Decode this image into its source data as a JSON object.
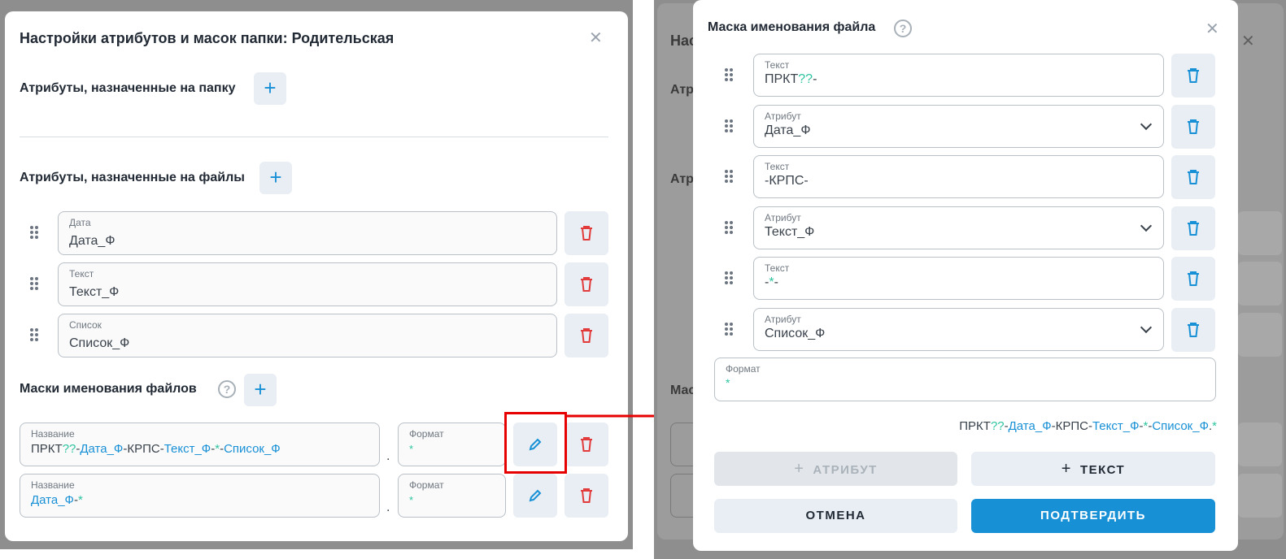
{
  "left": {
    "title": "Настройки атрибутов и масок папки: Родительская",
    "folder_attrs_label": "Атрибуты, назначенные на папку",
    "file_attrs_label": "Атрибуты, назначенные на файлы",
    "file_attrs": [
      {
        "label": "Дата",
        "value": "Дата_Ф"
      },
      {
        "label": "Текст",
        "value": "Текст_Ф"
      },
      {
        "label": "Список",
        "value": "Список_Ф"
      }
    ],
    "masks_label": "Маски именования файлов",
    "masks": [
      {
        "name_label": "Название",
        "name_parts": [
          {
            "t": "ПРКТ",
            "c": "dark"
          },
          {
            "t": "??",
            "c": "green"
          },
          {
            "t": "-",
            "c": "dark"
          },
          {
            "t": "Дата_Ф",
            "c": "blue"
          },
          {
            "t": "-КРПС-",
            "c": "dark"
          },
          {
            "t": "Текст_Ф",
            "c": "blue"
          },
          {
            "t": "-",
            "c": "dark"
          },
          {
            "t": "*",
            "c": "green"
          },
          {
            "t": "-",
            "c": "dark"
          },
          {
            "t": "Список_Ф",
            "c": "blue"
          }
        ],
        "format_label": "Формат",
        "format_value": "*"
      },
      {
        "name_label": "Название",
        "name_parts": [
          {
            "t": "Дата_Ф",
            "c": "blue"
          },
          {
            "t": "-",
            "c": "dark"
          },
          {
            "t": "*",
            "c": "green"
          }
        ],
        "format_label": "Формат",
        "format_value": "*"
      }
    ]
  },
  "right": {
    "title": "Маска именования файла",
    "rows": [
      {
        "label": "Текст",
        "parts": [
          {
            "t": "ПРКТ",
            "c": "dark"
          },
          {
            "t": "??",
            "c": "green"
          },
          {
            "t": "-",
            "c": "dark"
          }
        ],
        "dropdown": false
      },
      {
        "label": "Атрибут",
        "parts": [
          {
            "t": "Дата_Ф",
            "c": "dark"
          }
        ],
        "dropdown": true
      },
      {
        "label": "Текст",
        "parts": [
          {
            "t": "-КРПС-",
            "c": "dark"
          }
        ],
        "dropdown": false
      },
      {
        "label": "Атрибут",
        "parts": [
          {
            "t": "Текст_Ф",
            "c": "dark"
          }
        ],
        "dropdown": true
      },
      {
        "label": "Текст",
        "parts": [
          {
            "t": "-",
            "c": "dark"
          },
          {
            "t": "*",
            "c": "green"
          },
          {
            "t": "-",
            "c": "dark"
          }
        ],
        "dropdown": false
      },
      {
        "label": "Атрибут",
        "parts": [
          {
            "t": "Список_Ф",
            "c": "dark"
          }
        ],
        "dropdown": true
      }
    ],
    "format_label": "Формат",
    "format_value": "*",
    "preview_parts": [
      {
        "t": "ПРКТ",
        "c": "dark"
      },
      {
        "t": "??",
        "c": "green"
      },
      {
        "t": "-",
        "c": "dark"
      },
      {
        "t": "Дата_Ф",
        "c": "blue"
      },
      {
        "t": "-КРПС-",
        "c": "dark"
      },
      {
        "t": "Текст_Ф",
        "c": "blue"
      },
      {
        "t": "-",
        "c": "dark"
      },
      {
        "t": "*",
        "c": "green"
      },
      {
        "t": "-",
        "c": "dark"
      },
      {
        "t": "Список_Ф",
        "c": "blue"
      },
      {
        "t": ".",
        "c": "dark"
      },
      {
        "t": "*",
        "c": "green"
      }
    ],
    "add_attr_label": "АТРИБУТ",
    "add_text_label": "ТЕКСТ",
    "cancel_label": "ОТМЕНА",
    "confirm_label": "ПОДТВЕРДИТЬ"
  },
  "colors": {
    "accent": "#1890d6",
    "danger": "#e23b3b",
    "highlight": "#e60000",
    "green": "#2ec4a0"
  }
}
